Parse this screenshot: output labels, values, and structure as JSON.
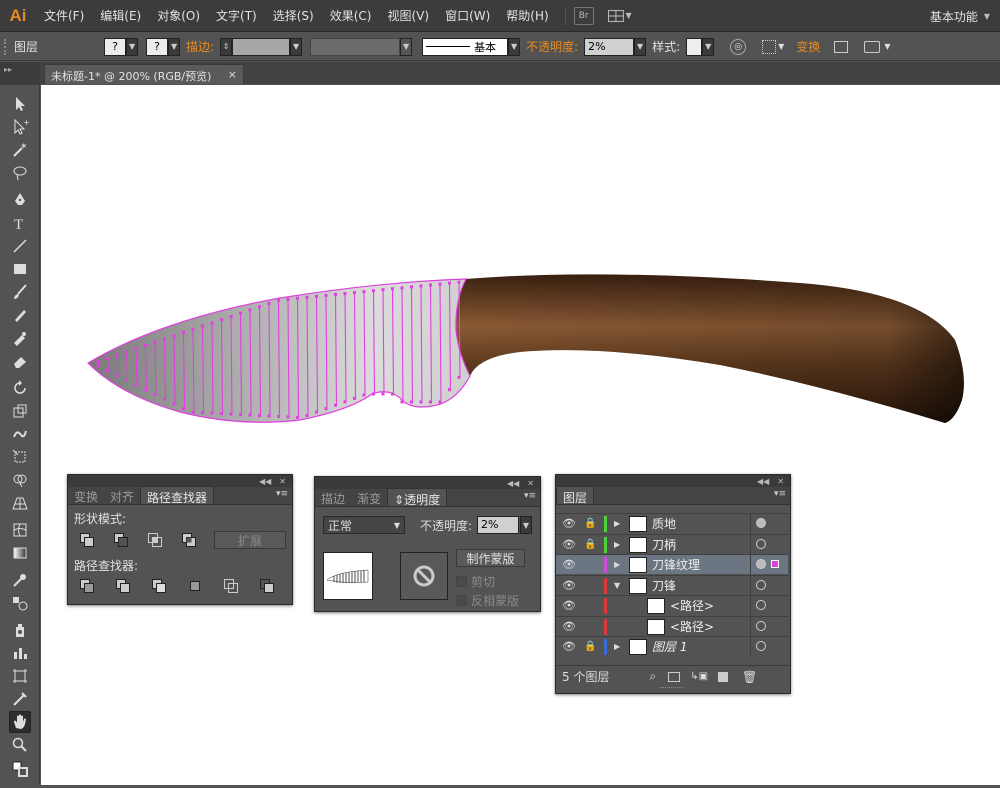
{
  "app": {
    "logo": "Ai",
    "workspace": "基本功能"
  },
  "menu": [
    "文件(F)",
    "编辑(E)",
    "对象(O)",
    "文字(T)",
    "选择(S)",
    "效果(C)",
    "视图(V)",
    "窗口(W)",
    "帮助(H)"
  ],
  "menu_extra": {
    "bridge": "Br"
  },
  "control": {
    "selection_label": "图层",
    "stroke_label": "描边:",
    "brush_value": "基本",
    "opacity_label": "不透明度:",
    "opacity_value": "2%",
    "style_label": "样式:",
    "transform_label": "变换",
    "q1": "?",
    "q2": "?"
  },
  "document": {
    "tab_title": "未标题-1* @ 200% (RGB/预览)",
    "close": "×"
  },
  "pathfinder_panel": {
    "tabs": [
      "变换",
      "对齐",
      "路径查找器"
    ],
    "shape_modes_label": "形状模式:",
    "expand_button": "扩展",
    "pathfinders_label": "路径查找器:"
  },
  "transparency_panel": {
    "tabs": [
      "描边",
      "渐变",
      "透明度"
    ],
    "blend_mode": "正常",
    "opacity_label": "不透明度:",
    "opacity_value": "2%",
    "make_mask_button": "制作蒙版",
    "clip_label": "剪切",
    "invert_label": "反相蒙版"
  },
  "layers_panel": {
    "tab": "图层",
    "layers": [
      {
        "name": "质地",
        "color": "#4fd13a",
        "locked": true,
        "expand": "▶",
        "indent": 0
      },
      {
        "name": "刀柄",
        "color": "#4fd13a",
        "locked": true,
        "expand": "▶",
        "indent": 0
      },
      {
        "name": "刀锋纹理",
        "color": "#c84fd6",
        "locked": false,
        "expand": "▶",
        "indent": 0,
        "selected": true
      },
      {
        "name": "刀锋",
        "color": "#d63a3a",
        "locked": false,
        "expand": "▼",
        "indent": 0
      },
      {
        "name": "<路径>",
        "color": "#d63a3a",
        "locked": false,
        "expand": "",
        "indent": 1
      },
      {
        "name": "<路径>",
        "color": "#d63a3a",
        "locked": false,
        "expand": "",
        "indent": 1
      },
      {
        "name": "图层 1",
        "color": "#3a6ad6",
        "locked": true,
        "expand": "▶",
        "indent": 0,
        "italic": true
      }
    ],
    "footer_count": "5 个图层"
  },
  "colors": {
    "accent": "#e88b1f",
    "selection": "#e040e0",
    "panel": "#535353"
  }
}
